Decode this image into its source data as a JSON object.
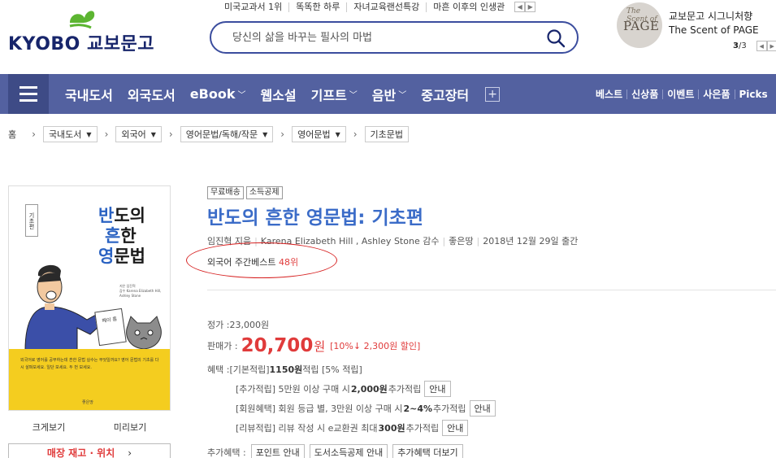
{
  "header": {
    "logo_text": "KYOBO 교보문고",
    "top_links": [
      "미국교과서 1위",
      "똑똑한 하루",
      "자녀교육랜선특강",
      "마흔 이후의 인생관"
    ],
    "search_placeholder": "당신의 삶을 바꾸는 필사의 마법",
    "promo": {
      "image_script": "The Scent of",
      "image_title": "PAGE",
      "line1": "교보문고 시그니처향",
      "line2": "The Scent of PAGE",
      "current": "3",
      "total": "/3"
    }
  },
  "nav": {
    "items": [
      {
        "label": "국내도서",
        "dropdown": false
      },
      {
        "label": "외국도서",
        "dropdown": false
      },
      {
        "label": "eBook",
        "dropdown": true
      },
      {
        "label": "웹소설",
        "dropdown": false
      },
      {
        "label": "기프트",
        "dropdown": true
      },
      {
        "label": "음반",
        "dropdown": true
      },
      {
        "label": "중고장터",
        "dropdown": false
      }
    ],
    "right": [
      "베스트",
      "신상품",
      "이벤트",
      "사은품",
      "Picks"
    ]
  },
  "breadcrumb": {
    "home": "홈",
    "items": [
      "국내도서",
      "외국어",
      "영어문법/독해/작문",
      "영어문법",
      "기초문법"
    ]
  },
  "cover": {
    "label": "기초편",
    "title_l1a": "반",
    "title_l1b": "도의",
    "title_l2a": "흔",
    "title_l2b": "한",
    "title_l3a": "영",
    "title_l3b": "문법",
    "note": "메이 홈",
    "publisher": "좋은땅",
    "blurb": "외국어로 영어를 공부하는데 흔한 문법 실수는 무엇일까요? 영어 문법의 기초를 다시 살펴보세요. 일단 보세요. 두 번 보세요."
  },
  "cover_links": {
    "enlarge": "크게보기",
    "preview": "미리보기"
  },
  "stock_button": "매장 재고 · 위치",
  "book": {
    "tags": [
      "무료배송",
      "소득공제"
    ],
    "title": "반도의 흔한 영문법: 기초편",
    "author": "임진혁 지음",
    "translator": "Karena Elizabeth Hill , Ashley Stone 감수",
    "publisher": "좋은땅",
    "date": "2018년 12월 29일 출간",
    "bestseller_prefix": "외국어 주간베스트 ",
    "bestseller_rank": "48위"
  },
  "price": {
    "list_label": "정가 : ",
    "list_value": "23,000원",
    "sale_label": "판매가 : ",
    "sale_value": "20,700",
    "sale_unit": "원",
    "discount": "[10%↓ 2,300원 할인]",
    "benefit_label": "혜택 : ",
    "benefit_text1": "[기본적립] ",
    "benefit_points": "1150원",
    "benefit_text2": " 적립 [5% 적립]"
  },
  "benefits": [
    {
      "pre": "[추가적립] 5만원 이상 구매 시 ",
      "bold": "2,000원",
      "post": " 추가적립",
      "btn": "안내"
    },
    {
      "pre": "[회원혜택] 회원 등급 별, 3만원 이상 구매 시 ",
      "bold": "2~4%",
      "post": " 추가적립",
      "btn": "안내"
    },
    {
      "pre": "[리뷰적립] 리뷰 작성 시 e교환권 최대 ",
      "bold": "300원",
      "post": " 추가적립",
      "btn": "안내"
    }
  ],
  "extra": {
    "label": "추가혜택 : ",
    "buttons": [
      "포인트 안내",
      "도서소득공제 안내",
      "추가혜택 더보기"
    ]
  },
  "colors": {
    "brand_navy": "#17256b",
    "nav_bg": "#5361a0",
    "title_blue": "#3b6cc8",
    "price_red": "#e03b3b",
    "logo_green": "#5cb531"
  }
}
